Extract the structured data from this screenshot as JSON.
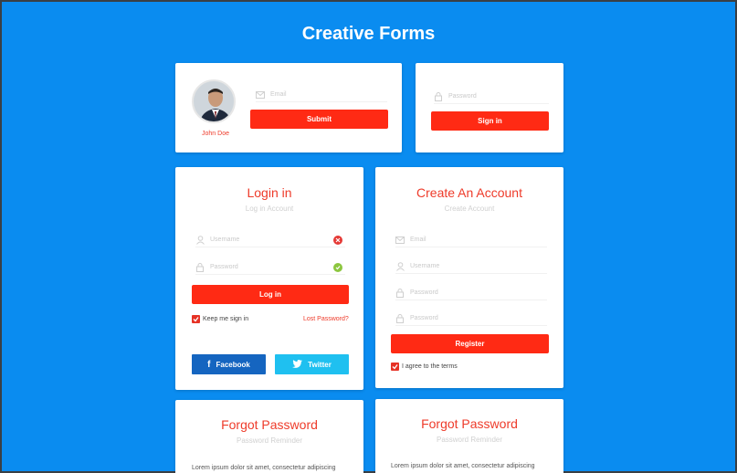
{
  "header": {
    "title": "Creative Forms"
  },
  "profile_card": {
    "name": "John Doe",
    "email_placeholder": "Email",
    "submit_label": "Submit"
  },
  "signin_card": {
    "password_placeholder": "Password",
    "signin_label": "Sign in"
  },
  "login_card": {
    "title": "Login in",
    "subtitle": "Log in Account",
    "username_placeholder": "Username",
    "password_placeholder": "Password",
    "login_label": "Log in",
    "keep_signed_label": "Keep me sign in",
    "lost_password_label": "Lost Password?",
    "facebook_label": "Facebook",
    "twitter_label": "Twitter"
  },
  "register_card": {
    "title": "Create An Account",
    "subtitle": "Create Account",
    "email_placeholder": "Email",
    "username_placeholder": "Username",
    "password_placeholder": "Password",
    "confirm_placeholder": "Password",
    "register_label": "Register",
    "agree_label": "I agree to the terms"
  },
  "forgot_card_1": {
    "title": "Forgot Password",
    "subtitle": "Password Reminder",
    "body": "Lorem ipsum dolor sit amet, consectetur adipiscing"
  },
  "forgot_card_2": {
    "title": "Forgot Password",
    "subtitle": "Password Reminder",
    "body": "Lorem ipsum dolor sit amet, consectetur adipiscing"
  },
  "colors": {
    "background": "#0a8cf0",
    "accent": "#ff2a14",
    "facebook": "#1565c0",
    "twitter": "#1fc0f0"
  }
}
